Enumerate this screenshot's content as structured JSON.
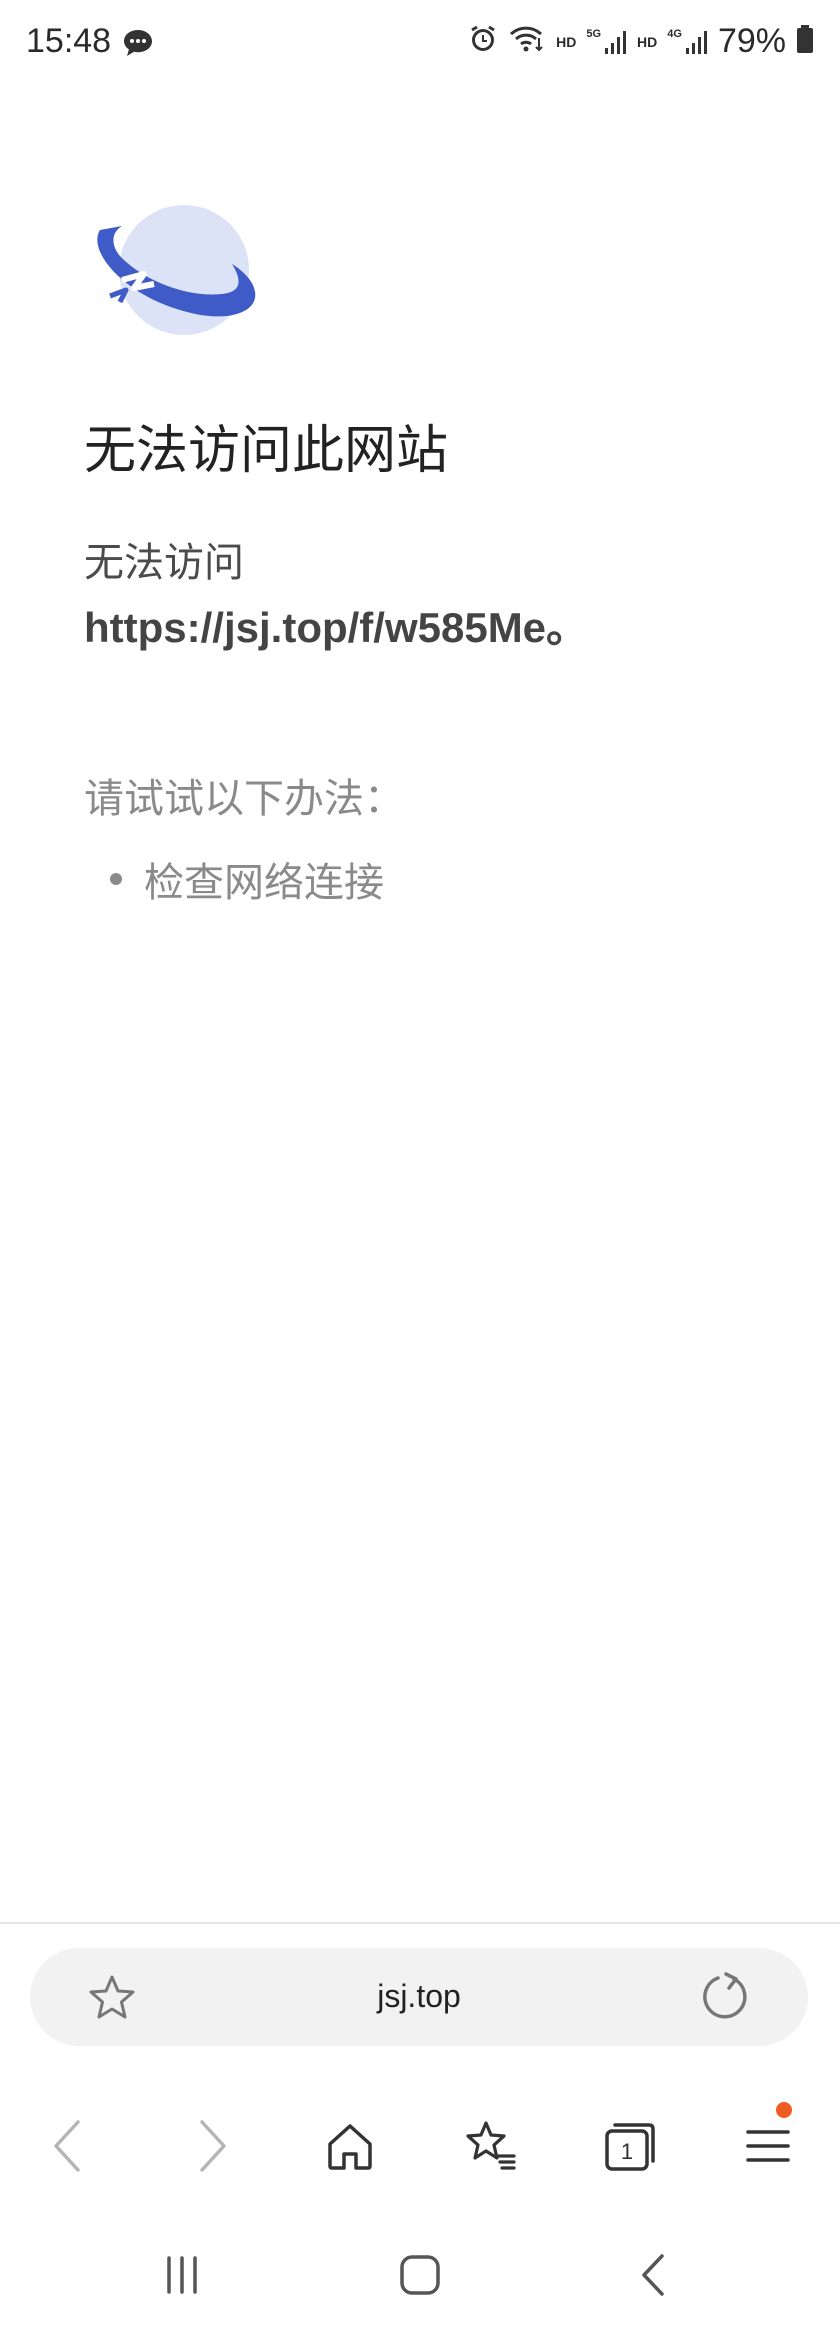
{
  "status_bar": {
    "time": "15:48",
    "network_labels": [
      "HD",
      "5G",
      "HD",
      "4G"
    ],
    "battery": "79%"
  },
  "error": {
    "title": "无法访问此网站",
    "line1": "无法访问",
    "url": "https://jsj.top/f/w585Me。",
    "hint": "请试试以下办法：",
    "suggestions": [
      "检查网络连接"
    ]
  },
  "address_bar": {
    "domain": "jsj.top"
  },
  "bottom_nav": {
    "icons": [
      "back-icon",
      "forward-icon",
      "home-icon",
      "bookmarks-icon",
      "tabs-icon",
      "menu-icon"
    ],
    "tabs_count": "1",
    "menu_badge_color": "#f15a22"
  },
  "colors": {
    "logo_blue": "#3f5bc7",
    "logo_light": "#dde3f7"
  }
}
